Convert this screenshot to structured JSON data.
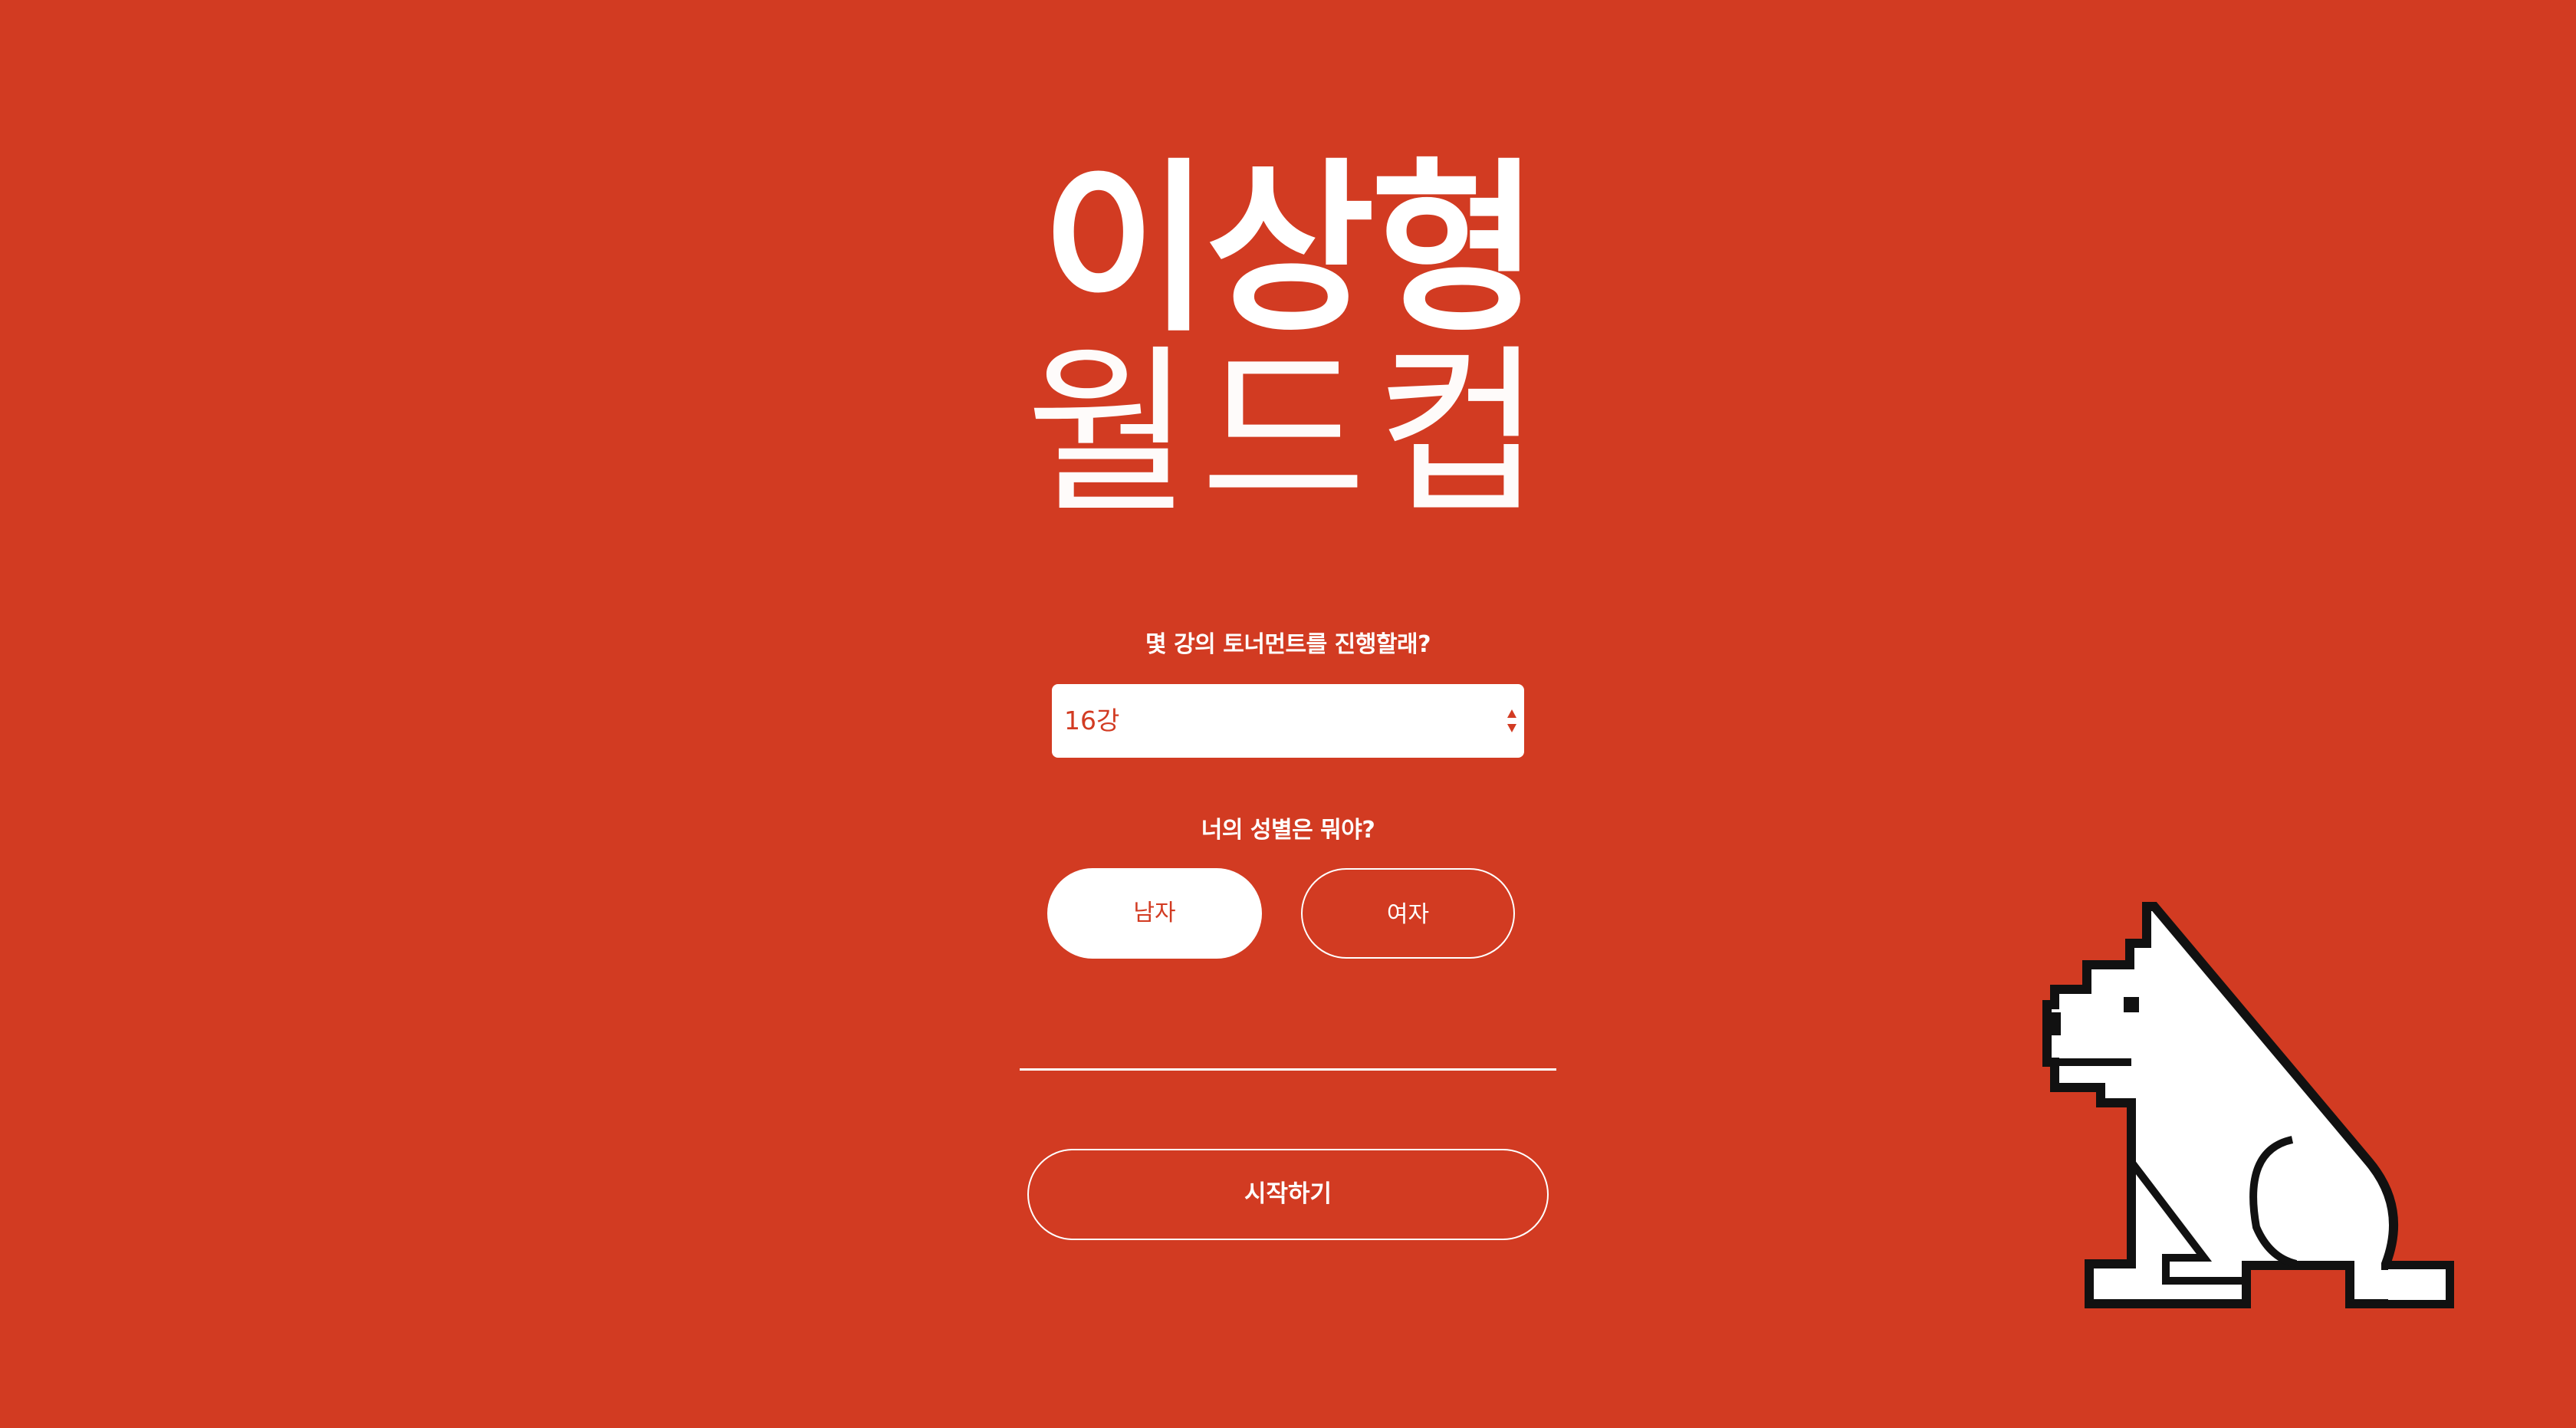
{
  "theme": {
    "background": "#d23b22",
    "foreground": "#ffffff"
  },
  "title": {
    "main": "이상형",
    "sub": "월드컵"
  },
  "round_select": {
    "question": "몇 강의 토너먼트를 진행할래?",
    "selected": "16강"
  },
  "gender": {
    "question": "너의 성별은 뭐야?",
    "options": [
      "남자",
      "여자"
    ],
    "selected": "남자"
  },
  "start_button": {
    "label": "시작하기"
  },
  "mascot": {
    "icon": "dog-mascot-icon"
  }
}
